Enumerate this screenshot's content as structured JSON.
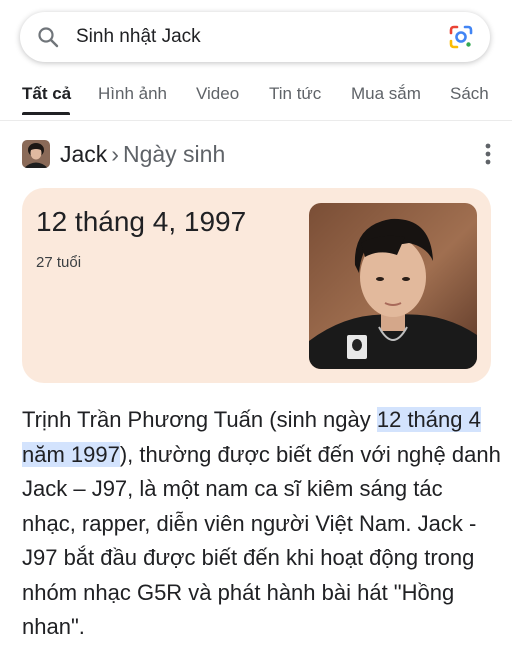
{
  "search": {
    "query": "Sinh nhật Jack",
    "search_icon": "search-icon",
    "lens_icon": "google-lens-icon"
  },
  "tabs": [
    {
      "label": "Tất cả",
      "active": true
    },
    {
      "label": "Hình ảnh",
      "active": false
    },
    {
      "label": "Video",
      "active": false
    },
    {
      "label": "Tin tức",
      "active": false
    },
    {
      "label": "Mua sắm",
      "active": false
    },
    {
      "label": "Sách",
      "active": false
    }
  ],
  "entity": {
    "name": "Jack",
    "separator": "›",
    "attribute": "Ngày sinh",
    "more_icon": "more-vert-icon"
  },
  "answer": {
    "date": "12 tháng 4, 1997",
    "age": "27 tuổi"
  },
  "description": {
    "before": "Trịnh Trần Phương Tuấn (sinh ngày ",
    "highlight": "12 tháng 4 năm 1997",
    "after": "), thường được biết đến với nghệ danh Jack – J97, là một nam ca sĩ kiêm sáng tác nhạc, rapper, diễn viên người Việt Nam. Jack - J97 bắt đầu được biết đến khi hoạt động trong nhóm nhạc G5R và phát hành bài hát \"Hồng nhan\"."
  },
  "colors": {
    "card_bg": "#fbe9dc",
    "highlight_bg": "#d3e3fd"
  }
}
